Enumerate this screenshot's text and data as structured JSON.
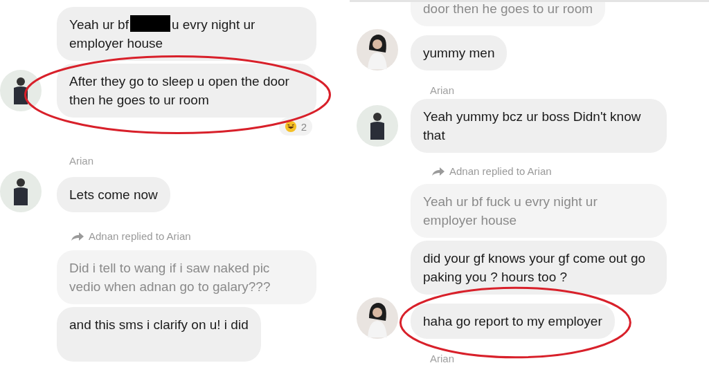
{
  "panels": [
    {
      "items": [
        {
          "kind": "message",
          "faded": false,
          "circled": false,
          "segments": [
            {
              "kind": "text",
              "text": "Yeah ur bf"
            },
            {
              "kind": "redaction"
            },
            {
              "kind": "text",
              "text": "u evry night ur employer house"
            }
          ]
        },
        {
          "kind": "message",
          "avatar": {
            "kind": "man"
          },
          "faded": false,
          "circled": true,
          "reaction_count": "2",
          "segments": [
            {
              "kind": "text",
              "text": "After  they go to sleep  u open the door then he goes to ur room"
            }
          ]
        },
        {
          "kind": "sender",
          "text": "Arian"
        },
        {
          "kind": "message",
          "avatar": {
            "kind": "man"
          },
          "faded": false,
          "circled": false,
          "segments": [
            {
              "kind": "text",
              "text": "Lets come now"
            }
          ]
        },
        {
          "kind": "reply_note",
          "text": "Adnan replied to Arian"
        },
        {
          "kind": "message",
          "faded": true,
          "circled": false,
          "segments": [
            {
              "kind": "text",
              "text": "Did i tell to wang if i saw naked pic vedio when adnan go to galary???"
            }
          ]
        },
        {
          "kind": "message",
          "faded": false,
          "circled": false,
          "cut_bottom": true,
          "segments": [
            {
              "kind": "text",
              "text": "and this sms i clarify on u! i did"
            }
          ]
        }
      ]
    },
    {
      "items": [
        {
          "kind": "message",
          "faded": true,
          "circled": false,
          "cut_top": true,
          "segments": [
            {
              "kind": "text",
              "text": "door then he goes to ur room"
            }
          ]
        },
        {
          "kind": "message",
          "avatar": {
            "kind": "woman"
          },
          "faded": false,
          "circled": false,
          "segments": [
            {
              "kind": "text",
              "text": "yummy men"
            }
          ]
        },
        {
          "kind": "sender",
          "text": "Arian"
        },
        {
          "kind": "message",
          "avatar": {
            "kind": "man"
          },
          "faded": false,
          "circled": false,
          "segments": [
            {
              "kind": "text",
              "text": "Yeah  yummy bcz ur boss Didn't know  that"
            }
          ]
        },
        {
          "kind": "reply_note",
          "text": "Adnan replied to Arian"
        },
        {
          "kind": "message",
          "faded": true,
          "circled": false,
          "segments": [
            {
              "kind": "text",
              "text": "Yeah ur bf fuck u evry night ur employer house"
            }
          ]
        },
        {
          "kind": "message",
          "faded": false,
          "circled": false,
          "segments": [
            {
              "kind": "text",
              "text": "did your gf knows your gf come out go paking you ? hours too ?"
            }
          ]
        },
        {
          "kind": "message",
          "avatar": {
            "kind": "woman"
          },
          "faded": false,
          "circled": true,
          "segments": [
            {
              "kind": "text",
              "text": "haha go report to my employer"
            }
          ]
        },
        {
          "kind": "sender",
          "text": "Arian"
        }
      ]
    }
  ]
}
